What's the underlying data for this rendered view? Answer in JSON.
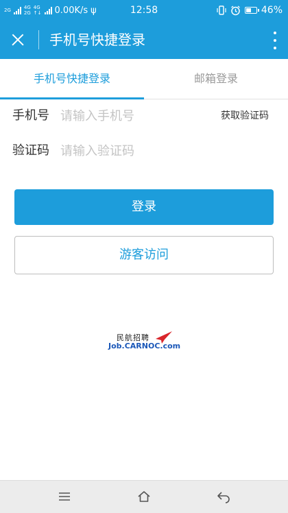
{
  "status_bar": {
    "network_top": "2G",
    "network_2a": "4G",
    "network_2b": "2G",
    "network_4g": "4G",
    "speed": "0.00K/s",
    "time": "12:58",
    "battery": "46%",
    "icons": [
      "signal-icon",
      "usb-icon",
      "vibrate-icon",
      "alarm-icon",
      "battery-icon"
    ]
  },
  "app_bar": {
    "title": "手机号快捷登录",
    "close_icon": "close-icon",
    "more_icon": "more-vertical-icon"
  },
  "tabs": [
    {
      "label": "手机号快捷登录",
      "active": true
    },
    {
      "label": "邮箱登录",
      "active": false
    }
  ],
  "form": {
    "phone": {
      "label": "手机号",
      "placeholder": "请输入手机号",
      "value": ""
    },
    "code": {
      "label": "验证码",
      "placeholder": "请输入验证码",
      "value": ""
    },
    "get_code_label": "获取验证码"
  },
  "buttons": {
    "login": "登录",
    "guest": "游客访问"
  },
  "logo": {
    "cn": "民航招聘",
    "en": "Job.CARNOC.com"
  },
  "colors": {
    "accent": "#1d9ddb",
    "inactive_tab": "#9a9a9a",
    "placeholder": "#c4c4c4",
    "logo_blue": "#1a57b8",
    "logo_red": "#d9262c"
  },
  "nav_bar": {
    "icons": [
      "menu-icon",
      "home-icon",
      "back-icon"
    ]
  }
}
